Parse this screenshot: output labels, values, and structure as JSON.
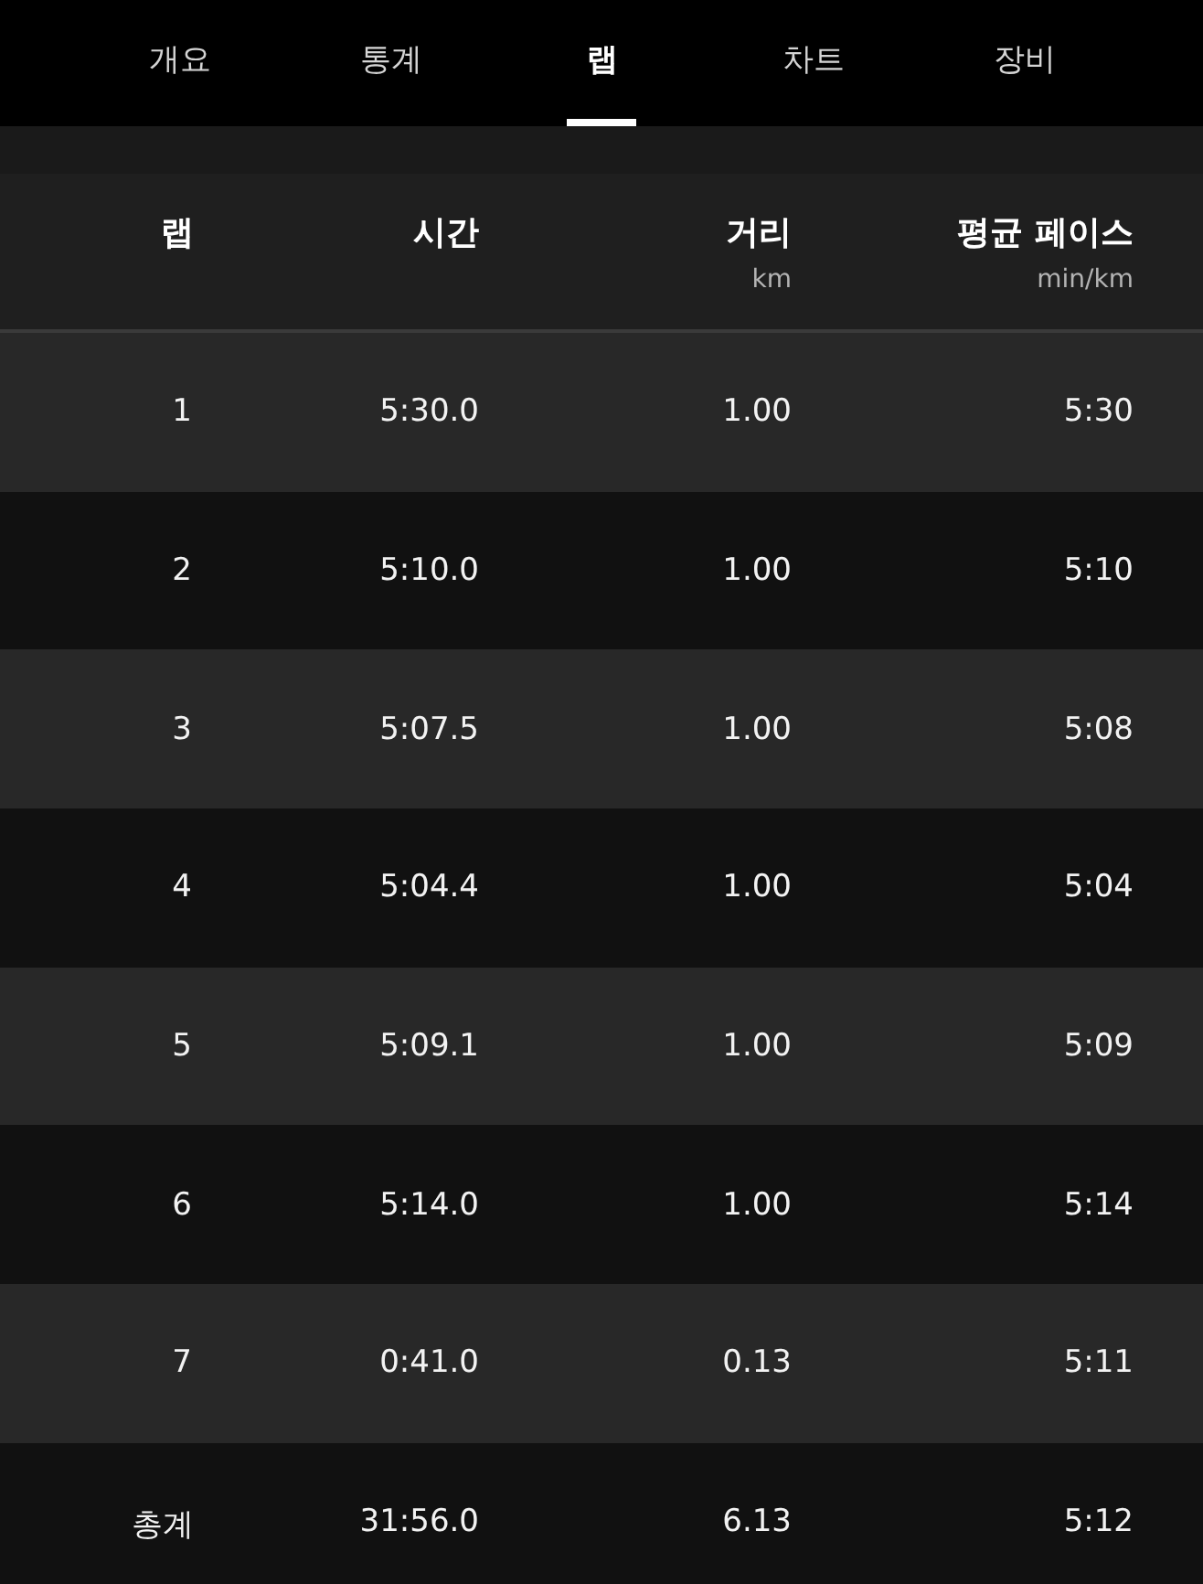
{
  "tabs": [
    {
      "label": "개요",
      "selected": false
    },
    {
      "label": "통계",
      "selected": false
    },
    {
      "label": "랩",
      "selected": true
    },
    {
      "label": "차트",
      "selected": false
    },
    {
      "label": "장비",
      "selected": false
    }
  ],
  "table": {
    "columns": [
      {
        "label": "랩"
      },
      {
        "label": "시간"
      },
      {
        "label": "거리",
        "unit": "km"
      },
      {
        "label": "평균 페이스",
        "unit": "min/km"
      }
    ],
    "rows": [
      [
        "1",
        "5:30.0",
        "1.00",
        "5:30"
      ],
      [
        "2",
        "5:10.0",
        "1.00",
        "5:10"
      ],
      [
        "3",
        "5:07.5",
        "1.00",
        "5:08"
      ],
      [
        "4",
        "5:04.4",
        "1.00",
        "5:04"
      ],
      [
        "5",
        "5:09.1",
        "1.00",
        "5:09"
      ],
      [
        "6",
        "5:14.0",
        "1.00",
        "5:14"
      ],
      [
        "7",
        "0:41.0",
        "0.13",
        "5:11"
      ]
    ],
    "total": [
      "총계",
      "31:56.0",
      "6.13",
      "5:12"
    ]
  }
}
